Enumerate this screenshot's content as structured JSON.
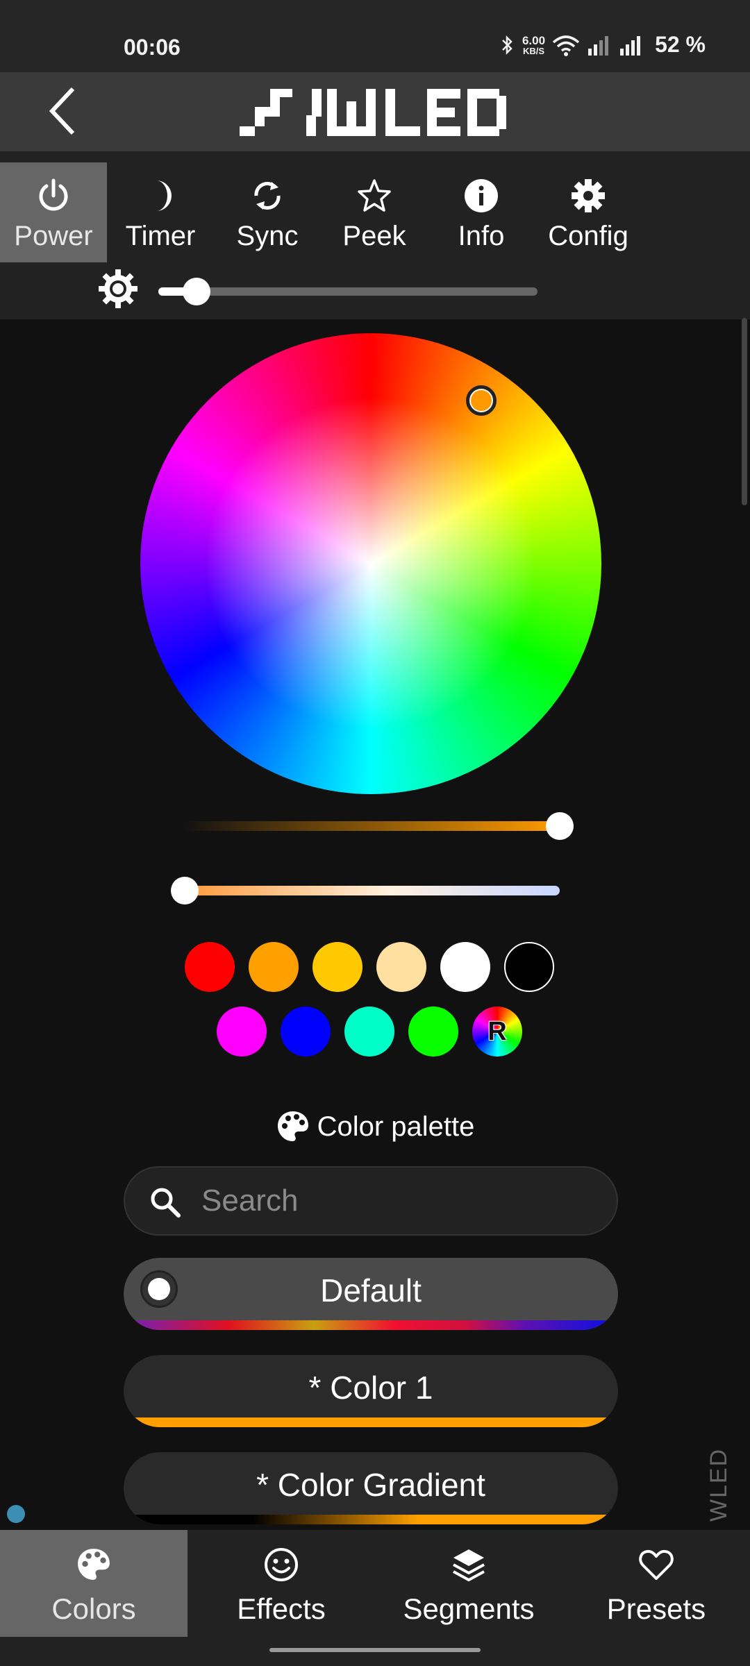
{
  "status_bar": {
    "time": "00:06",
    "net_speed_value": "6.00",
    "net_speed_unit": "KB/S",
    "battery": "52 %"
  },
  "header": {
    "logo_text": "WLED"
  },
  "top_nav": {
    "items": [
      {
        "label": "Power",
        "icon": "power-icon",
        "active": true
      },
      {
        "label": "Timer",
        "icon": "moon-icon",
        "active": false
      },
      {
        "label": "Sync",
        "icon": "sync-icon",
        "active": false
      },
      {
        "label": "Peek",
        "icon": "star-icon",
        "active": false
      },
      {
        "label": "Info",
        "icon": "info-icon",
        "active": false
      },
      {
        "label": "Config",
        "icon": "gear-icon",
        "active": false
      }
    ]
  },
  "brightness": {
    "icon": "brightness-icon",
    "value": 0.1
  },
  "color_picker": {
    "selected_color": "#ff9900",
    "value_slider": 1.0,
    "kelvin_slider": 0.0
  },
  "quick_colors": {
    "row1": [
      "#ff0000",
      "#ffa000",
      "#ffc800",
      "#ffe0a0",
      "#ffffff",
      "#000000"
    ],
    "row2": [
      "#ff00ff",
      "#0000ff",
      "#00ffc8",
      "#08ff00"
    ],
    "random_label": "R"
  },
  "palette": {
    "title": "Color palette",
    "search_placeholder": "Search",
    "items": [
      {
        "name": "Default",
        "selected": true
      },
      {
        "name": "* Color 1",
        "selected": false
      },
      {
        "name": "* Color Gradient",
        "selected": false
      }
    ]
  },
  "side_label": "WLED",
  "bottom_nav": {
    "items": [
      {
        "label": "Colors",
        "icon": "palette-icon",
        "active": true
      },
      {
        "label": "Effects",
        "icon": "smiley-icon",
        "active": false
      },
      {
        "label": "Segments",
        "icon": "layers-icon",
        "active": false
      },
      {
        "label": "Presets",
        "icon": "heart-icon",
        "active": false
      }
    ]
  }
}
